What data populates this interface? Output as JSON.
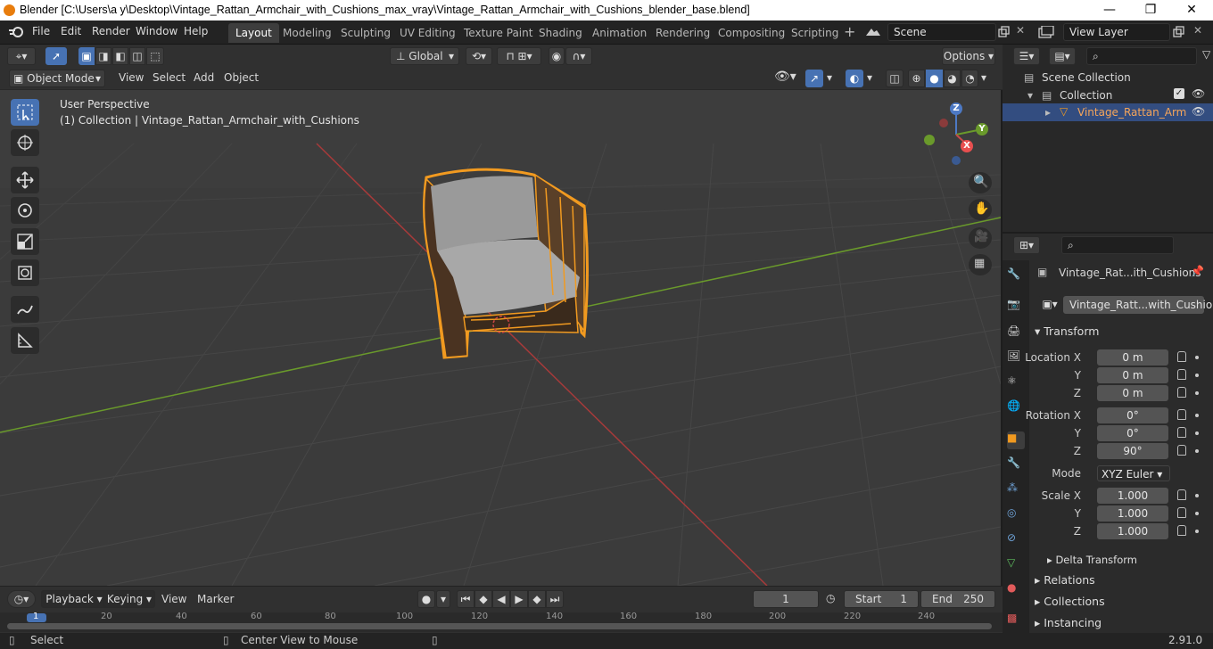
{
  "window": {
    "title": "Blender [C:\\Users\\a y\\Desktop\\Vintage_Rattan_Armchair_with_Cushions_max_vray\\Vintage_Rattan_Armchair_with_Cushions_blender_base.blend]",
    "minimize": "—",
    "maximize": "❐",
    "close": "✕"
  },
  "menu": {
    "file": "File",
    "edit": "Edit",
    "render": "Render",
    "window": "Window",
    "help": "Help"
  },
  "workspaces": [
    "Layout",
    "Modeling",
    "Sculpting",
    "UV Editing",
    "Texture Paint",
    "Shading",
    "Animation",
    "Rendering",
    "Compositing",
    "Scripting"
  ],
  "scene": "Scene",
  "view_layer": "View Layer",
  "header": {
    "transform_orientation": "Global",
    "options": "Options",
    "mode": "Object Mode",
    "view": "View",
    "select": "Select",
    "add": "Add",
    "object": "Object"
  },
  "viewport": {
    "perspective": "User Perspective",
    "collection_info": "(1) Collection | Vintage_Rattan_Armchair_with_Cushions",
    "gizmo": {
      "x": "X",
      "y": "Y",
      "z": "Z"
    }
  },
  "outliner": {
    "scene_collection": "Scene Collection",
    "collection": "Collection",
    "object": "Vintage_Rattan_Arm"
  },
  "properties": {
    "object_name": "Vintage_Rat...ith_Cushions",
    "data_name": "Vintage_Ratt...with_Cushions",
    "transform": "Transform",
    "location_label": "Location X",
    "y_label": "Y",
    "z_label": "Z",
    "location": [
      "0 m",
      "0 m",
      "0 m"
    ],
    "rotation_label": "Rotation X",
    "rotation": [
      "0°",
      "0°",
      "90°"
    ],
    "mode_label": "Mode",
    "mode_value": "XYZ Euler",
    "scale_label": "Scale X",
    "scale": [
      "1.000",
      "1.000",
      "1.000"
    ],
    "delta_transform": "Delta Transform",
    "relations": "Relations",
    "collections": "Collections",
    "instancing": "Instancing"
  },
  "timeline": {
    "playback": "Playback",
    "keying": "Keying",
    "view": "View",
    "marker": "Marker",
    "current_frame": "1",
    "start_label": "Start",
    "start": "1",
    "end_label": "End",
    "end": "250",
    "ticks": [
      "1",
      "20",
      "40",
      "60",
      "80",
      "100",
      "120",
      "140",
      "160",
      "180",
      "200",
      "220",
      "240"
    ]
  },
  "status": {
    "select": "Select",
    "center_view": "Center View to Mouse",
    "version": "2.91.0"
  },
  "colors": {
    "accent": "#4772b3",
    "selection": "#f19a20",
    "x_axis": "#a83a3a",
    "y_axis": "#6a9a2b"
  }
}
